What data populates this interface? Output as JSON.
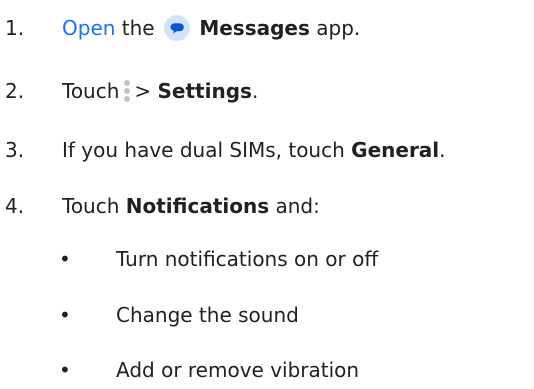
{
  "steps": [
    {
      "number": "1.",
      "link": "Open",
      "text_a": "the",
      "icon": "messages-app-icon",
      "bold": "Messages",
      "text_b": "app."
    },
    {
      "number": "2.",
      "text_a": "Touch",
      "icon": "more-vert-icon",
      "text_b": ">",
      "bold": "Settings",
      "text_c": "."
    },
    {
      "number": "3.",
      "text_a": "If you have dual SIMs, touch",
      "bold": "General",
      "text_b": "."
    },
    {
      "number": "4.",
      "text_a": "Touch",
      "bold": "Notifications",
      "text_b": "and:"
    }
  ],
  "sub_items": [
    {
      "bullet": "•",
      "text": "Turn notifications on or off"
    },
    {
      "bullet": "•",
      "text": "Change the sound"
    },
    {
      "bullet": "•",
      "text": "Add or remove vibration"
    }
  ],
  "colors": {
    "link": "#1a73e8",
    "icon_bg": "#d3e3fd",
    "icon_bubble": "#0b57d0",
    "menu_dots": "#c4c7c5"
  }
}
